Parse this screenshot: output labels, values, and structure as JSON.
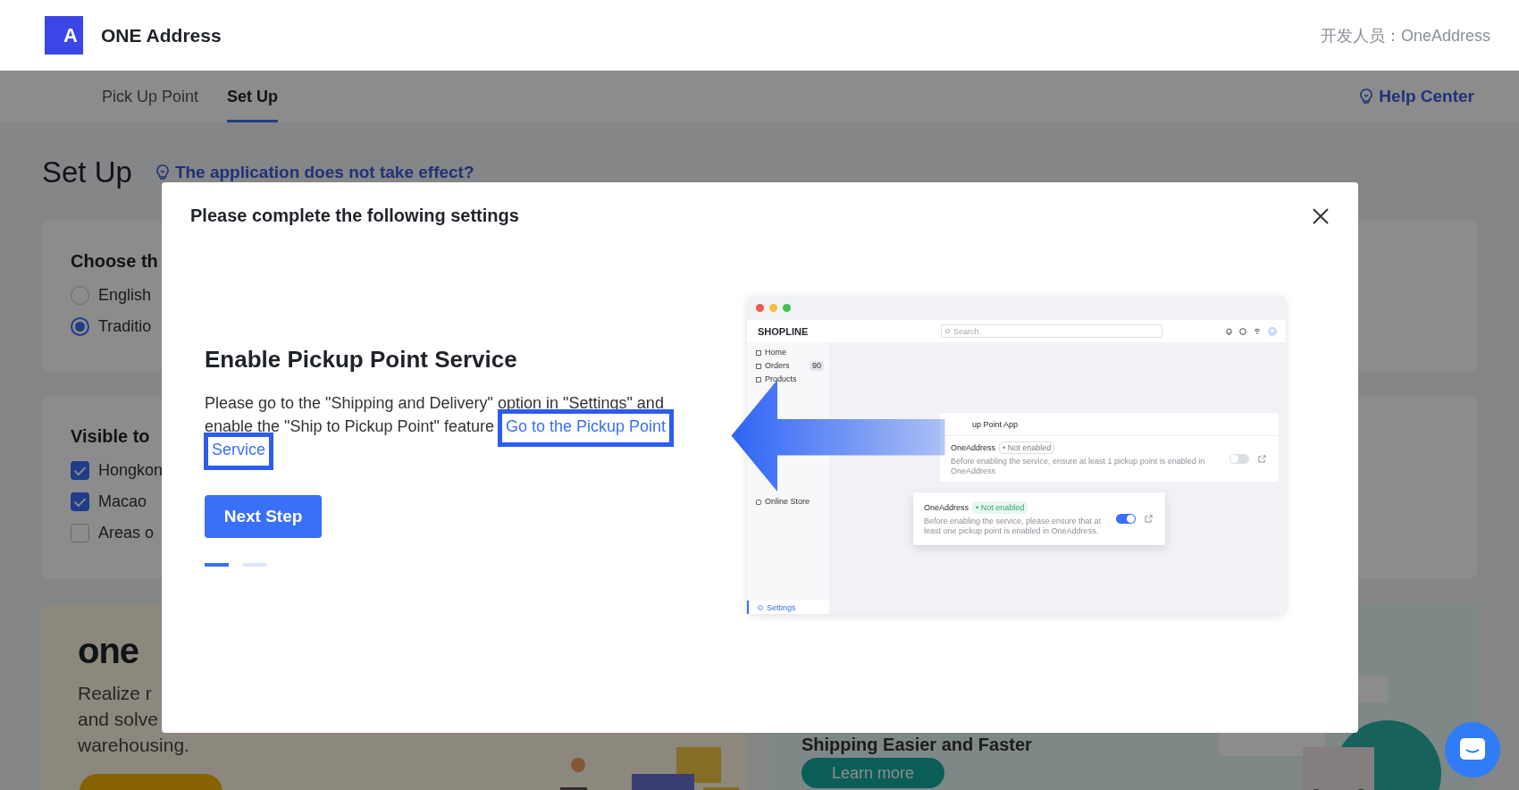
{
  "header": {
    "logo": "A",
    "app_name": "ONE Address",
    "developer_label": "开发人员：",
    "developer": "OneAddress"
  },
  "nav": {
    "tabs": [
      {
        "label": "Pick Up Point",
        "selected": false
      },
      {
        "label": "Set Up",
        "selected": true
      }
    ],
    "help": "Help Center"
  },
  "page": {
    "title": "Set Up",
    "hint_link": "The application does not take effect?"
  },
  "language_card": {
    "title": "Choose th",
    "options": [
      {
        "label": "English",
        "selected": false
      },
      {
        "label": "Traditio",
        "selected": true
      }
    ]
  },
  "visibility_card": {
    "title": "Visible to",
    "options": [
      {
        "label": "Hongkon",
        "checked": true
      },
      {
        "label": "Macao",
        "checked": true
      },
      {
        "label": "Areas o",
        "checked": false
      }
    ]
  },
  "promo_left": {
    "brand": "one",
    "lines": [
      "Realize r",
      "and solve",
      "warehousing."
    ]
  },
  "promo_right": {
    "headline": "Shipping Easier and Faster",
    "button": "Learn more"
  },
  "modal": {
    "title": "Please complete the following settings",
    "heading": "Enable Pickup Point Service",
    "text": "Please go to the \"Shipping and Delivery\" option in \"Settings\" and enable the \"Ship to Pickup Point\" feature",
    "link": "Go to the Pickup Point Service",
    "button": "Next Step",
    "steps": [
      {
        "selected": true
      },
      {
        "selected": false
      }
    ],
    "preview": {
      "brand": "SHOPLINE",
      "search": "Search",
      "menu": [
        {
          "label": "Home"
        },
        {
          "label": "Orders",
          "badge": "90"
        },
        {
          "label": "Products"
        }
      ],
      "channel": "Online Store",
      "settings": "Settings",
      "panel_title": "up Point App",
      "cards": [
        {
          "name": "OneAddress",
          "status": "• Not enabled",
          "text": "Before enabling the service, ensure at least 1 pickup point is enabled in OneAddress",
          "on": false
        },
        {
          "name": "OneAddress",
          "status": "• Not enabled",
          "text": "Before enabling the service, please ensure that at least one pickup point is enabled in OneAddress.",
          "on": true
        }
      ]
    }
  }
}
